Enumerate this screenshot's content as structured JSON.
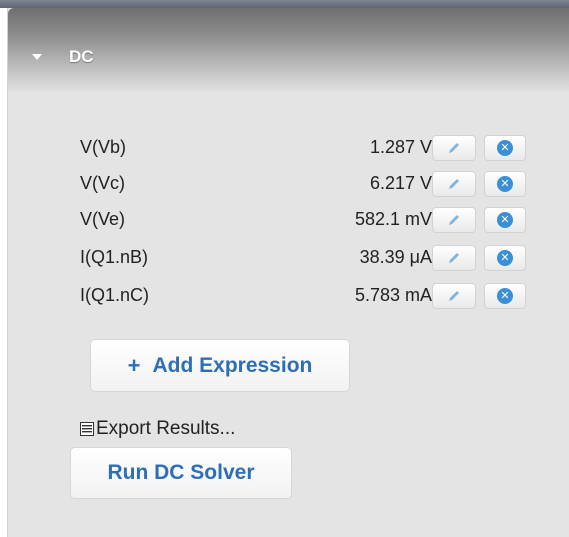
{
  "panel": {
    "title": "DC",
    "caret_icon": "caret-down-icon"
  },
  "results": [
    {
      "label": "V(Vb)",
      "value": "1.287 V"
    },
    {
      "label": "V(Vc)",
      "value": "6.217 V"
    },
    {
      "label": "V(Ve)",
      "value": "582.1 mV"
    },
    {
      "label": "I(Q1.nB)",
      "value": "38.39 μA"
    },
    {
      "label": "I(Q1.nC)",
      "value": "5.783 mA"
    }
  ],
  "row_icons": {
    "edit": "pencil-icon",
    "remove": "remove-circle-icon"
  },
  "add_expression": {
    "plus": "+",
    "label": "Add Expression"
  },
  "export": {
    "label": "Export Results...",
    "icon": "list-icon"
  },
  "run_button": {
    "label": "Run DC Solver"
  },
  "colors": {
    "accent": "#2d6fb7",
    "remove_icon": "#3a8fd6",
    "panel_bg": "#e4e4e4"
  }
}
